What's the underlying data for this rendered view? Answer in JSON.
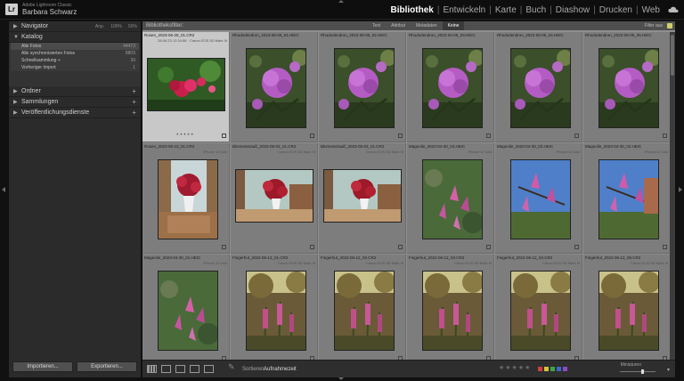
{
  "app": {
    "name": "Adobe Lightroom Classic",
    "user": "Barbara Schwarz",
    "logo": "Lr"
  },
  "modules": [
    {
      "label": "Bibliothek",
      "active": true
    },
    {
      "label": "Entwickeln",
      "active": false
    },
    {
      "label": "Karte",
      "active": false
    },
    {
      "label": "Buch",
      "active": false
    },
    {
      "label": "Diashow",
      "active": false
    },
    {
      "label": "Drucken",
      "active": false
    },
    {
      "label": "Web",
      "active": false
    }
  ],
  "left_panel": {
    "navigator": {
      "label": "Navigator",
      "zooms": [
        "Anp.",
        "100%",
        "50%"
      ]
    },
    "catalog": {
      "label": "Katalog",
      "items": [
        {
          "label": "Alle Fotos",
          "count": "44473"
        },
        {
          "label": "Alle synchronisierten Fotos",
          "count": "8809"
        },
        {
          "label": "Schnellsammlung +",
          "count": "39"
        },
        {
          "label": "Vorheriger Import",
          "count": "1"
        }
      ]
    },
    "folders": {
      "label": "Ordner"
    },
    "collections": {
      "label": "Sammlungen"
    },
    "publish": {
      "label": "Veröffentlichungsdienste"
    },
    "import_button": "Importieren...",
    "export_button": "Exportieren..."
  },
  "filter_bar": {
    "title": "Bibliotheksfilter:",
    "tabs": [
      "Text",
      "Attribut",
      "Metadaten",
      "Keine"
    ],
    "active_tab": "Keine",
    "preset": "Filter aus"
  },
  "grid": {
    "cells": [
      {
        "name": "Rosen_2023-06-28_01.CR2",
        "sub": "28.06.23 12:34:58 · Canon EOS 5D Mark III",
        "photo": "roses",
        "orientation": "landscape",
        "selected": true
      },
      {
        "name": "Rhododendron_2023-06-05_01.HEIC",
        "sub": "",
        "photo": "rhodo",
        "orientation": "portrait"
      },
      {
        "name": "Rhododendron_2023-06-05_02.HEIC",
        "sub": "",
        "photo": "rhodo2",
        "orientation": "portrait"
      },
      {
        "name": "Rhododendron_2023-04-05_03.HEIC",
        "sub": "",
        "photo": "rhodo",
        "orientation": "portrait"
      },
      {
        "name": "Rhododendron_2023-06-05_04.HEIC",
        "sub": "",
        "photo": "rhodo2",
        "orientation": "portrait"
      },
      {
        "name": "Rhododendron_2023-06-05_05.HEIC",
        "sub": "",
        "photo": "rhodo",
        "orientation": "portrait"
      },
      {
        "name": "Rosen_2023-06-10_01.CR2",
        "sub": "iPhone 12 mini",
        "photo": "roses_table",
        "orientation": "portrait"
      },
      {
        "name": "Blumenstrauß_2023-05-03_01.CR2",
        "sub": "Canon EOS 5D Mark III",
        "photo": "bouquet",
        "orientation": "landscape"
      },
      {
        "name": "Blumenstrauß_2023-05-03_01.CR2",
        "sub": "Canon EOS 5D Mark III",
        "photo": "bouquet",
        "orientation": "landscape"
      },
      {
        "name": "Magnolie_2023-04-30_04.HEIC",
        "sub": "iPhone 12 mini",
        "photo": "magnolia",
        "orientation": "portrait"
      },
      {
        "name": "Magnolie_2023-04-30_03.HEIC",
        "sub": "iPhone 12 mini",
        "photo": "magnolia_sky",
        "orientation": "portrait"
      },
      {
        "name": "Magnolie_2023-04-30_02.HEIC",
        "sub": "iPhone 12 mini",
        "photo": "magnolia_sky2",
        "orientation": "portrait"
      },
      {
        "name": "Magnolie_2023-04-30_01.HEIC",
        "sub": "iPhone 12 mini",
        "photo": "magnolia",
        "orientation": "portrait"
      },
      {
        "name": "Fingerhut_2022-06-12_01.CR2",
        "sub": "Canon EOS 5D Mark III",
        "photo": "foxglove",
        "orientation": "portrait"
      },
      {
        "name": "Fingerhut_2022-06-12_02.CR2",
        "sub": "Canon EOS 5D Mark III",
        "photo": "foxglove",
        "orientation": "portrait"
      },
      {
        "name": "Fingerhut_2022-06-12_03.CR2",
        "sub": "Canon EOS 5D Mark III",
        "photo": "foxglove",
        "orientation": "portrait"
      },
      {
        "name": "Fingerhut_2022-06-12_04.CR2",
        "sub": "Canon EOS 5D Mark III",
        "photo": "foxglove",
        "orientation": "portrait"
      },
      {
        "name": "Fingerhut_2022-06-12_05.CR2",
        "sub": "Canon EOS 5D Mark III",
        "photo": "foxglove",
        "orientation": "portrait"
      }
    ]
  },
  "toolbar": {
    "sort_label": "Sortieren:",
    "sort_value": "Aufnahmezeit",
    "thumbnail_label": "Miniaturen",
    "color_labels": [
      "#d23c3c",
      "#d8c23a",
      "#3fa447",
      "#3b68c9",
      "#8a4bc4"
    ]
  }
}
